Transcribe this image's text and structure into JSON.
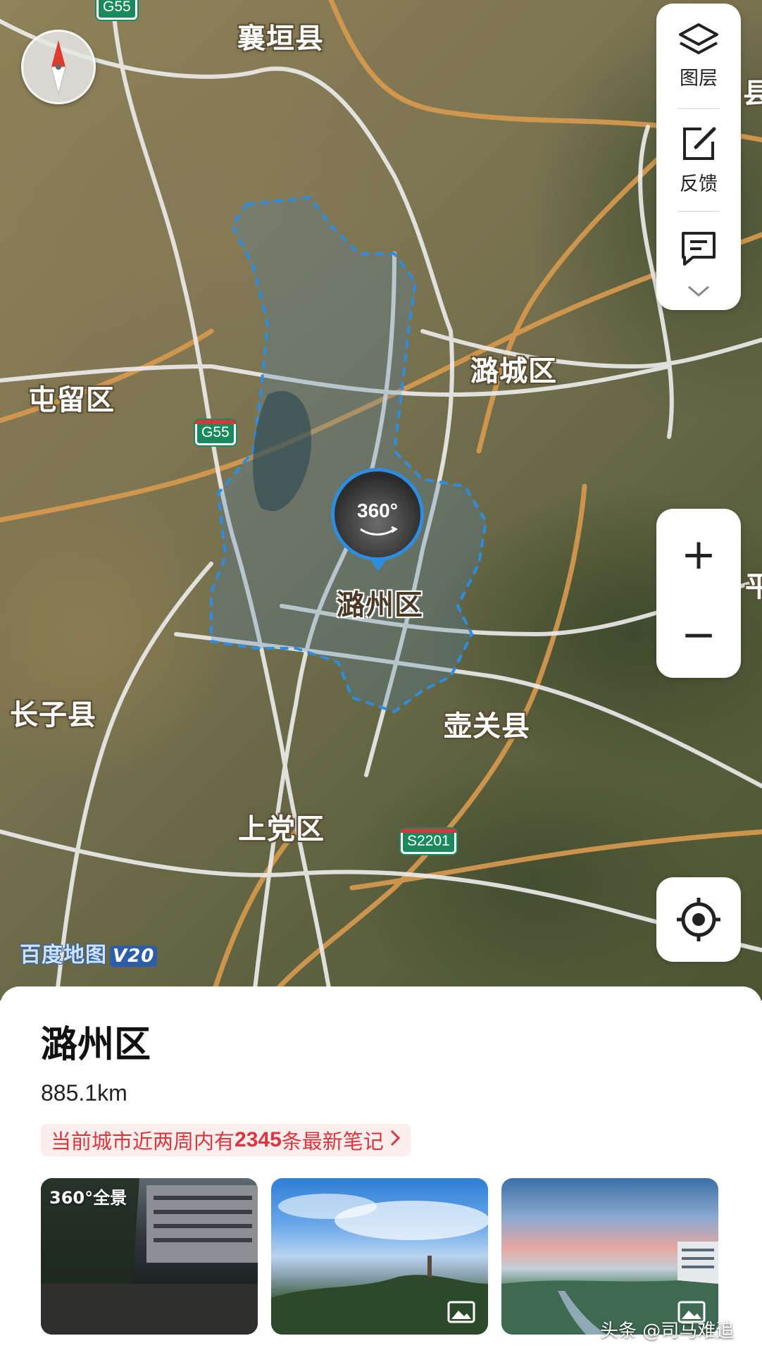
{
  "map": {
    "labels": {
      "xiangyuan": "襄垣县",
      "lucheng": "潞城区",
      "tunliu": "屯留区",
      "zhangzi": "长子县",
      "huguan": "壶关县",
      "shangdang": "上党区",
      "luzhou": "潞州区",
      "edge_top": "县",
      "edge_mid": "平"
    },
    "highway_shields": {
      "top": "G55",
      "mid": "G55",
      "s2201": "S2201"
    },
    "pano_marker": "360°",
    "logo_text": "百度地图",
    "logo_version": "V20"
  },
  "tools": {
    "layers": "图层",
    "feedback": "反馈"
  },
  "zoom": {
    "in": "+",
    "out": "−"
  },
  "sheet": {
    "title": "潞州区",
    "distance": "885.1km",
    "notes_prefix": "当前城市近两周内有",
    "notes_count": "2345",
    "notes_suffix": "条最新笔记",
    "pano_label": "360°全景"
  },
  "watermark": "头条 @司马难追",
  "colors": {
    "boundary": "#2f8de0",
    "accent_red": "#d9363e",
    "shield_green": "#1a8a5c"
  }
}
